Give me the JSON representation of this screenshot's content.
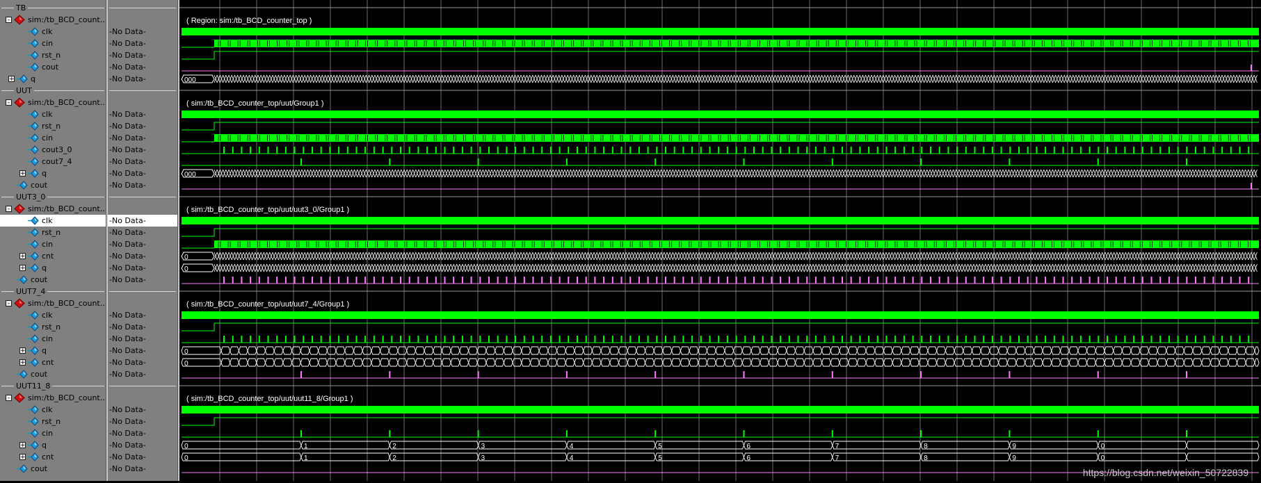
{
  "rows": [
    {
      "kind": "divider",
      "label": "TB"
    },
    {
      "kind": "region",
      "name": "sim:/tb_BCD_count...",
      "value": "",
      "indent": 0,
      "exp": "-",
      "wave": "none"
    },
    {
      "kind": "sig",
      "name": "clk",
      "value": "-No Data-",
      "indent": 1,
      "wave": "clock"
    },
    {
      "kind": "sig",
      "name": "cin",
      "value": "-No Data-",
      "indent": 1,
      "wave": "cinfast"
    },
    {
      "kind": "sig",
      "name": "rst_n",
      "value": "-No Data-",
      "indent": 1,
      "wave": "rst"
    },
    {
      "kind": "sig",
      "name": "cout",
      "value": "-No Data-",
      "indent": 1,
      "wave": "coutfinal"
    },
    {
      "kind": "sig",
      "name": "q",
      "value": "-No Data-",
      "indent": 0,
      "exp": "+",
      "wave": "busdense",
      "start": "000"
    },
    {
      "kind": "divider",
      "label": "UUT"
    },
    {
      "kind": "region",
      "name": "sim:/tb_BCD_count...",
      "value": "",
      "indent": 0,
      "exp": "-",
      "wave": "none"
    },
    {
      "kind": "sig",
      "name": "clk",
      "value": "-No Data-",
      "indent": 1,
      "wave": "clock"
    },
    {
      "kind": "sig",
      "name": "rst_n",
      "value": "-No Data-",
      "indent": 1,
      "wave": "rst"
    },
    {
      "kind": "sig",
      "name": "cin",
      "value": "-No Data-",
      "indent": 1,
      "wave": "cinfast"
    },
    {
      "kind": "sig",
      "name": "cout3_0",
      "value": "-No Data-",
      "indent": 1,
      "wave": "pulse10"
    },
    {
      "kind": "sig",
      "name": "cout7_4",
      "value": "-No Data-",
      "indent": 1,
      "wave": "pulse100"
    },
    {
      "kind": "sig",
      "name": "q",
      "value": "-No Data-",
      "indent": 1,
      "exp": "+",
      "wave": "busdense",
      "start": "000"
    },
    {
      "kind": "sig",
      "name": "cout",
      "value": "-No Data-",
      "indent": 0,
      "wave": "coutfinal"
    },
    {
      "kind": "divider",
      "label": "UUT3_0"
    },
    {
      "kind": "region",
      "name": "sim:/tb_BCD_count...",
      "value": "",
      "indent": 0,
      "exp": "-",
      "wave": "none"
    },
    {
      "kind": "sig",
      "name": "clk",
      "value": "-No Data-",
      "indent": 1,
      "wave": "clock",
      "selected": true
    },
    {
      "kind": "sig",
      "name": "rst_n",
      "value": "-No Data-",
      "indent": 1,
      "wave": "rst"
    },
    {
      "kind": "sig",
      "name": "cin",
      "value": "-No Data-",
      "indent": 1,
      "wave": "cinfast"
    },
    {
      "kind": "sig",
      "name": "cnt",
      "value": "-No Data-",
      "indent": 1,
      "exp": "+",
      "wave": "busdense",
      "start": "0"
    },
    {
      "kind": "sig",
      "name": "q",
      "value": "-No Data-",
      "indent": 1,
      "exp": "+",
      "wave": "busdense",
      "start": "0"
    },
    {
      "kind": "sig",
      "name": "cout",
      "value": "-No Data-",
      "indent": 0,
      "wave": "pulse10pink"
    },
    {
      "kind": "divider",
      "label": "UUT7_4"
    },
    {
      "kind": "region",
      "name": "sim:/tb_BCD_count...",
      "value": "",
      "indent": 0,
      "exp": "-",
      "wave": "none"
    },
    {
      "kind": "sig",
      "name": "clk",
      "value": "-No Data-",
      "indent": 1,
      "wave": "clock"
    },
    {
      "kind": "sig",
      "name": "rst_n",
      "value": "-No Data-",
      "indent": 1,
      "wave": "rst"
    },
    {
      "kind": "sig",
      "name": "cin",
      "value": "-No Data-",
      "indent": 1,
      "wave": "pulse10"
    },
    {
      "kind": "sig",
      "name": "q",
      "value": "-No Data-",
      "indent": 1,
      "exp": "+",
      "wave": "busmed",
      "start": "0"
    },
    {
      "kind": "sig",
      "name": "cnt",
      "value": "-No Data-",
      "indent": 1,
      "exp": "+",
      "wave": "busmed",
      "start": "0"
    },
    {
      "kind": "sig",
      "name": "cout",
      "value": "-No Data-",
      "indent": 0,
      "wave": "pulse100pink"
    },
    {
      "kind": "divider",
      "label": "UUT11_8"
    },
    {
      "kind": "region",
      "name": "sim:/tb_BCD_count...",
      "value": "",
      "indent": 0,
      "exp": "-",
      "wave": "none"
    },
    {
      "kind": "sig",
      "name": "clk",
      "value": "-No Data-",
      "indent": 1,
      "wave": "clock"
    },
    {
      "kind": "sig",
      "name": "rst_n",
      "value": "-No Data-",
      "indent": 1,
      "wave": "rst"
    },
    {
      "kind": "sig",
      "name": "cin",
      "value": "-No Data-",
      "indent": 1,
      "wave": "pulse100"
    },
    {
      "kind": "sig",
      "name": "q",
      "value": "-No Data-",
      "indent": 1,
      "exp": "+",
      "wave": "buscount"
    },
    {
      "kind": "sig",
      "name": "cnt",
      "value": "-No Data-",
      "indent": 1,
      "exp": "+",
      "wave": "buscount"
    },
    {
      "kind": "sig",
      "name": "cout",
      "value": "-No Data-",
      "indent": 0,
      "wave": "coutflat"
    }
  ],
  "region_labels": {
    "1": "( Region: sim:/tb_BCD_counter_top )",
    "8": "( sim:/tb_BCD_counter_top/uut/Group1 )",
    "17": "( sim:/tb_BCD_counter_top/uut/uut3_0/Group1 )",
    "25": "( sim:/tb_BCD_counter_top/uut/uut7_4/Group1 )",
    "33": "( sim:/tb_BCD_counter_top/uut/uut11_8/Group1 )"
  },
  "bus_count_labels": [
    "0",
    "1",
    "2",
    "3",
    "4",
    "5",
    "6",
    "7",
    "8",
    "9",
    "0"
  ],
  "colors": {
    "wave_green": "#00ff00",
    "wave_pink": "#ff7cff",
    "grid": "#6e6e6e",
    "panel": "#808080",
    "text_region": "#ffffff"
  },
  "icons": {
    "region": "red-diamond-icon",
    "signal": "blue-diamond-signal-icon"
  },
  "watermark": "https://blog.csdn.net/weixin_50722839"
}
